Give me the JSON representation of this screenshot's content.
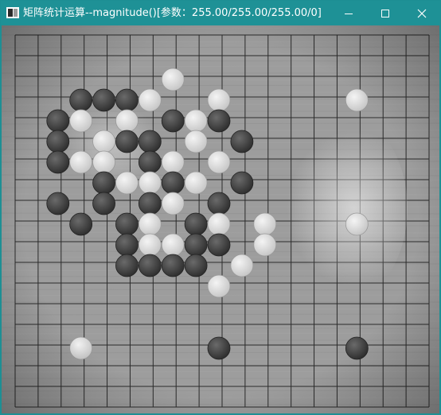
{
  "window": {
    "title": "矩阵统计运算--magnitude()[参数：255.00/255.00/255.00/0]",
    "controls": [
      {
        "name": "minimize-button",
        "icon": "minimize-icon"
      },
      {
        "name": "maximize-button",
        "icon": "maximize-icon"
      },
      {
        "name": "close-button",
        "icon": "close-icon"
      }
    ],
    "titlebar_color": "#1e9196"
  },
  "image_view": {
    "content": "grayscale Go board photo",
    "board_size": 19,
    "black_stone_color": "#3a3a3a",
    "white_stone_color": "#dcdcdc",
    "stones": [
      {
        "c": "w",
        "col": 6,
        "row": 2
      },
      {
        "c": "b",
        "col": 2,
        "row": 3
      },
      {
        "c": "b",
        "col": 3,
        "row": 3
      },
      {
        "c": "b",
        "col": 4,
        "row": 3
      },
      {
        "c": "w",
        "col": 5,
        "row": 3
      },
      {
        "c": "w",
        "col": 8,
        "row": 3
      },
      {
        "c": "w",
        "col": 14,
        "row": 3
      },
      {
        "c": "b",
        "col": 1,
        "row": 4
      },
      {
        "c": "w",
        "col": 2,
        "row": 4
      },
      {
        "c": "w",
        "col": 4,
        "row": 4
      },
      {
        "c": "b",
        "col": 6,
        "row": 4
      },
      {
        "c": "w",
        "col": 7,
        "row": 4
      },
      {
        "c": "b",
        "col": 8,
        "row": 4
      },
      {
        "c": "b",
        "col": 1,
        "row": 5
      },
      {
        "c": "w",
        "col": 3,
        "row": 5
      },
      {
        "c": "b",
        "col": 4,
        "row": 5
      },
      {
        "c": "b",
        "col": 5,
        "row": 5
      },
      {
        "c": "w",
        "col": 7,
        "row": 5
      },
      {
        "c": "b",
        "col": 9,
        "row": 5
      },
      {
        "c": "b",
        "col": 1,
        "row": 6
      },
      {
        "c": "w",
        "col": 2,
        "row": 6
      },
      {
        "c": "w",
        "col": 3,
        "row": 6
      },
      {
        "c": "b",
        "col": 5,
        "row": 6
      },
      {
        "c": "w",
        "col": 6,
        "row": 6
      },
      {
        "c": "w",
        "col": 8,
        "row": 6
      },
      {
        "c": "b",
        "col": 3,
        "row": 7
      },
      {
        "c": "w",
        "col": 4,
        "row": 7
      },
      {
        "c": "w",
        "col": 5,
        "row": 7
      },
      {
        "c": "b",
        "col": 6,
        "row": 7
      },
      {
        "c": "w",
        "col": 7,
        "row": 7
      },
      {
        "c": "b",
        "col": 9,
        "row": 7
      },
      {
        "c": "b",
        "col": 1,
        "row": 8
      },
      {
        "c": "b",
        "col": 3,
        "row": 8
      },
      {
        "c": "b",
        "col": 5,
        "row": 8
      },
      {
        "c": "w",
        "col": 6,
        "row": 8
      },
      {
        "c": "b",
        "col": 8,
        "row": 8
      },
      {
        "c": "b",
        "col": 2,
        "row": 9
      },
      {
        "c": "b",
        "col": 4,
        "row": 9
      },
      {
        "c": "w",
        "col": 5,
        "row": 9
      },
      {
        "c": "b",
        "col": 7,
        "row": 9
      },
      {
        "c": "w",
        "col": 8,
        "row": 9
      },
      {
        "c": "w",
        "col": 10,
        "row": 9
      },
      {
        "c": "w",
        "col": 14,
        "row": 9
      },
      {
        "c": "b",
        "col": 4,
        "row": 10
      },
      {
        "c": "w",
        "col": 5,
        "row": 10
      },
      {
        "c": "w",
        "col": 6,
        "row": 10
      },
      {
        "c": "b",
        "col": 7,
        "row": 10
      },
      {
        "c": "b",
        "col": 8,
        "row": 10
      },
      {
        "c": "w",
        "col": 10,
        "row": 10
      },
      {
        "c": "b",
        "col": 4,
        "row": 11
      },
      {
        "c": "b",
        "col": 5,
        "row": 11
      },
      {
        "c": "b",
        "col": 6,
        "row": 11
      },
      {
        "c": "b",
        "col": 7,
        "row": 11
      },
      {
        "c": "w",
        "col": 9,
        "row": 11
      },
      {
        "c": "w",
        "col": 8,
        "row": 12
      },
      {
        "c": "w",
        "col": 2,
        "row": 15
      },
      {
        "c": "b",
        "col": 8,
        "row": 15
      },
      {
        "c": "b",
        "col": 14,
        "row": 15
      }
    ]
  }
}
